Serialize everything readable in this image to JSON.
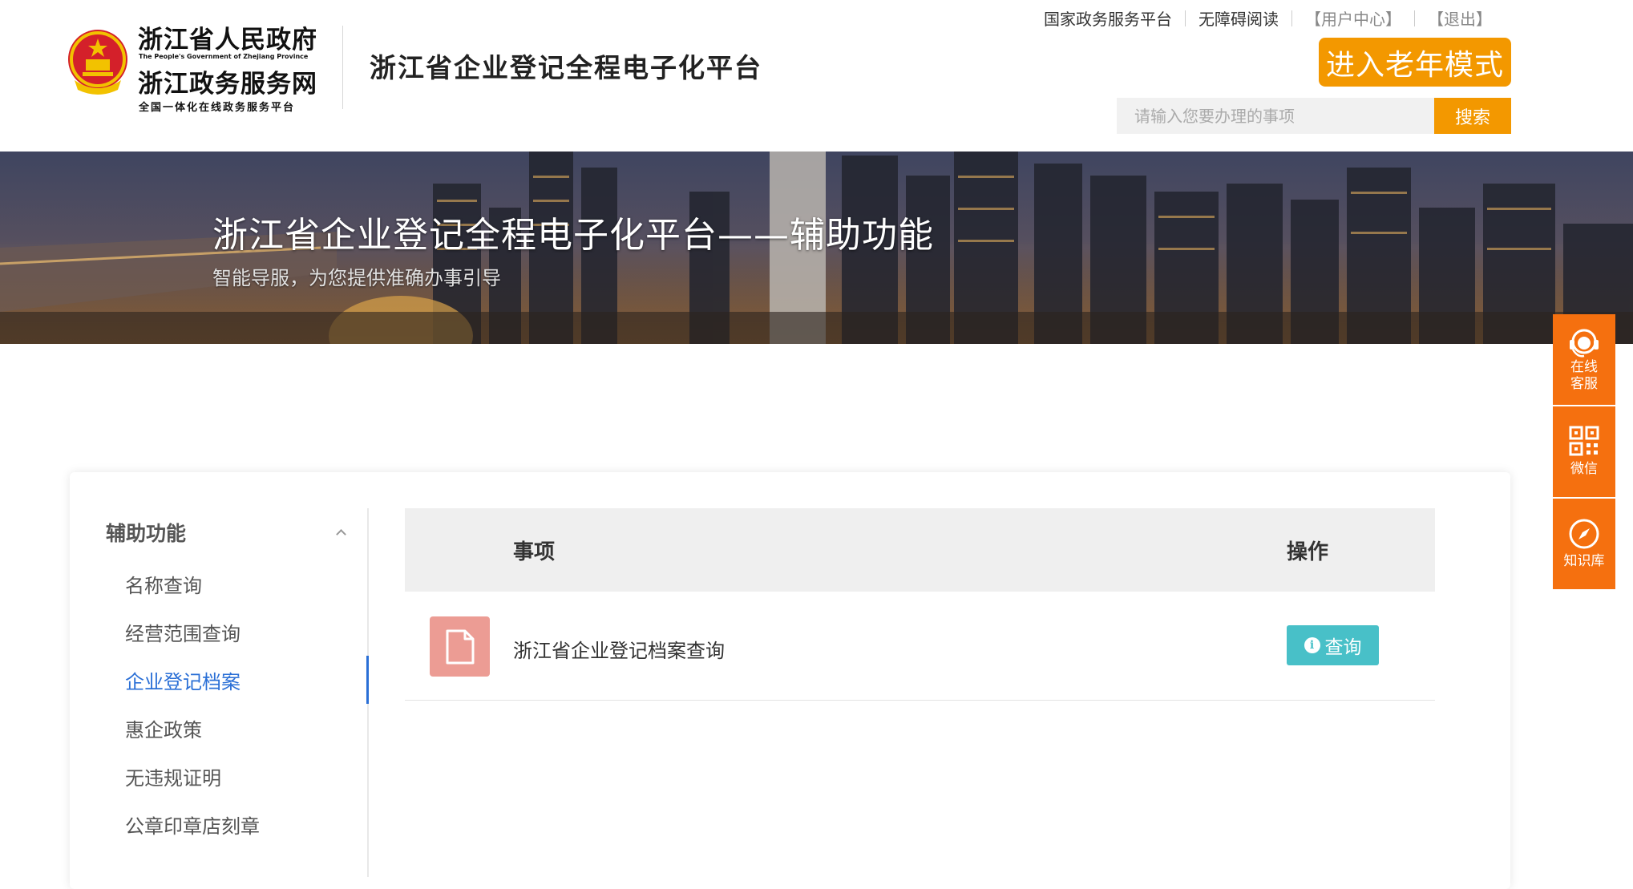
{
  "header": {
    "gov_title": "浙江省人民政府",
    "gov_title_en": "The People's Government of Zhejiang Province",
    "service_title": "浙江政务服务网",
    "service_sub": "全国一体化在线政务服务平台",
    "platform_name": "浙江省企业登记全程电子化平台",
    "links": {
      "national": "国家政务服务平台",
      "accessible": "无障碍阅读",
      "user_center": "【用户中心】",
      "logout": "【退出】"
    },
    "elder_mode": "进入老年模式",
    "search": {
      "placeholder": "请输入您要办理的事项",
      "button": "搜索"
    }
  },
  "banner": {
    "title": "浙江省企业登记全程电子化平台——辅助功能",
    "subtitle": "智能导服，为您提供准确办事引导"
  },
  "sidenav": {
    "heading": "辅助功能",
    "items": [
      "名称查询",
      "经营范围查询",
      "企业登记档案",
      "惠企政策",
      "无违规证明",
      "公章印章店刻章"
    ],
    "active_index": 2
  },
  "table": {
    "col_item": "事项",
    "col_op": "操作",
    "rows": [
      {
        "title": "浙江省企业登记档案查询",
        "action": "查询"
      }
    ]
  },
  "float_tools": [
    {
      "label": "在线\n客服",
      "icon": "headset-icon"
    },
    {
      "label": "微信",
      "icon": "qrcode-icon"
    },
    {
      "label": "知识库",
      "icon": "compass-icon"
    }
  ],
  "colors": {
    "accent": "#f39800",
    "float": "#f5700f",
    "active_link": "#2a6fd6",
    "query_button": "#48c0c8",
    "doc_icon": "#ec9c94"
  }
}
